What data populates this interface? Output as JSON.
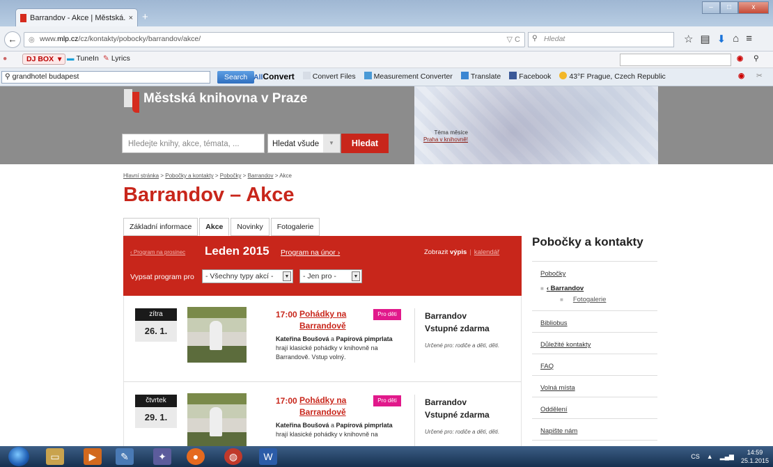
{
  "browser": {
    "tab_title": "Barrandov - Akce | Městská...",
    "tab_close": "×",
    "new_tab": "+",
    "url_prefix": "www.",
    "url_domain": "mlp.cz",
    "url_path": "/cz/kontakty/pobocky/barrandov/akce/",
    "url_tail": "▽ C",
    "search_placeholder": "Hledat",
    "window_controls": [
      "–",
      "□",
      "x"
    ]
  },
  "toolbar1": {
    "djbox": "DJ BOX",
    "tunein": "TuneIn",
    "lyrics": "Lyrics"
  },
  "toolbar2": {
    "search_value": "grandhotel budapest",
    "search_button": "Search",
    "allconvert_a": "All",
    "allconvert_b": "Convert",
    "links": [
      "Convert Files",
      "Measurement Converter",
      "Translate",
      "Facebook",
      "43°F Prague, Czech Republic"
    ]
  },
  "header": {
    "site_title": "Městská knihovna v Praze",
    "search_placeholder": "Hledejte knihy, akce, témata, ...",
    "search_scope": "Hledat všude",
    "search_button": "Hledat",
    "theme_label": "Téma měsíce",
    "theme_link": "Praha v knihovně!"
  },
  "breadcrumb": [
    "Hlavní stránka",
    "Pobočky a kontakty",
    "Pobočky",
    "Barrandov",
    "Akce"
  ],
  "page_title": "Barrandov – Akce",
  "tabs": [
    "Základní informace",
    "Akce",
    "Novinky",
    "Fotogalerie"
  ],
  "program": {
    "prev": "‹ Program na prosinec",
    "current": "Leden 2015",
    "next": "Program na únor ›",
    "view_label": "Zobrazit",
    "view_list": "výpis",
    "view_calendar": "kalendář",
    "filter_label": "Vypsat program pro",
    "filter_type": "- Všechny typy akcí -",
    "filter_for": "- Jen pro -"
  },
  "events": [
    {
      "day": "zítra",
      "date": "26. 1.",
      "time": "17:00",
      "title": "Pohádky na Barrandově",
      "badge": "Pro děti",
      "desc_a": "Kateřina Boušová",
      "desc_b": " a ",
      "desc_c": "Papírová pimprlata",
      "desc_d": " hrají klasické pohádky v knihovně na Barrandově. Vstup volný.",
      "place": "Barrandov",
      "price": "Vstupné zdarma",
      "target": "Určené pro: rodiče a děti, děti."
    },
    {
      "day": "čtvrtek",
      "date": "29. 1.",
      "time": "17:00",
      "title": "Pohádky na Barrandově",
      "badge": "Pro děti",
      "desc_a": "Kateřina Boušová",
      "desc_b": " a ",
      "desc_c": "Papírová pimprlata",
      "desc_d": " hrají klasické pohádky v knihovně na",
      "place": "Barrandov",
      "price": "Vstupné zdarma",
      "target": "Určené pro: rodiče a děti, děti."
    }
  ],
  "sidebar": {
    "title": "Pobočky a kontakty",
    "pobocky": "Pobočky",
    "current": "Barrandov",
    "sub": "Fotogalerie",
    "items": [
      "Bibliobus",
      "Důležité kontakty",
      "FAQ",
      "Volná místa",
      "Oddělení",
      "Napište nám"
    ]
  },
  "taskbar": {
    "lang": "CS",
    "time": "14:59",
    "date": "25.1.2015"
  }
}
